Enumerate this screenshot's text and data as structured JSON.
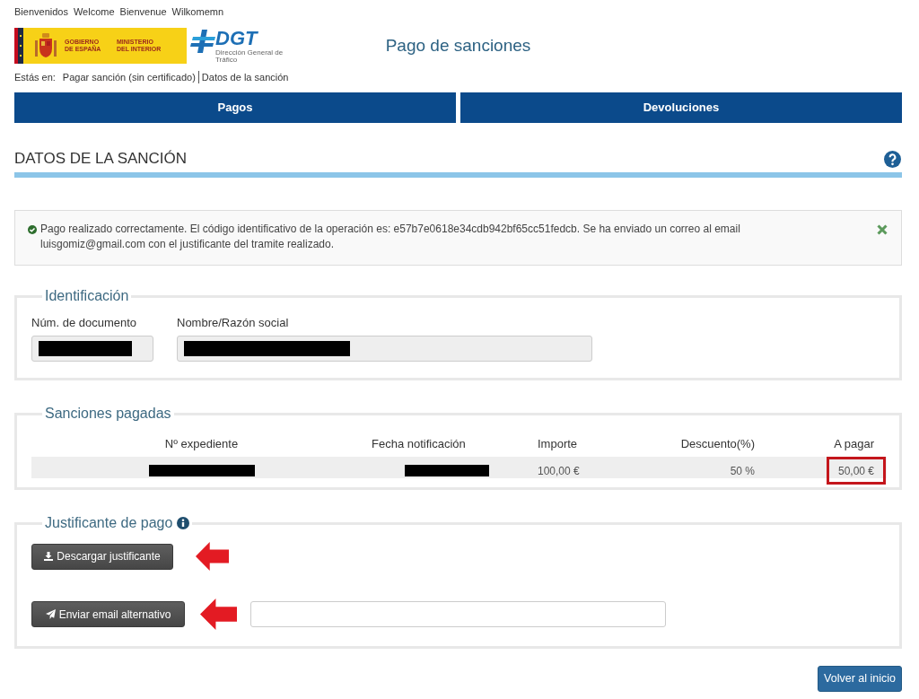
{
  "languages": [
    "Bienvenidos",
    "Welcome",
    "Bienvenue",
    "Wilkomemn"
  ],
  "header": {
    "government_logo": {
      "lines": [
        "GOBIERNO DE ESPAÑA",
        "MINISTERIO DEL INTERIOR"
      ]
    },
    "dgt_logo": {
      "name": "DGT",
      "subtitle": "Dirección General de Tráfico"
    },
    "title": "Pago de sanciones"
  },
  "breadcrumb": {
    "label": "Estás en:",
    "items": [
      "Pagar sanción (sin certificado)",
      "Datos de la sanción"
    ]
  },
  "nav": [
    "Pagos",
    "Devoluciones"
  ],
  "section_title": "DATOS DE LA SANCIÓN",
  "alert": {
    "message": "Pago realizado correctamente. El código identificativo de la operación es: e57b7e0618e34cdb942bf65cc51fedcb. Se ha enviado un correo al email luisgomiz@gmail.com con el justificante del tramite realizado."
  },
  "identificacion": {
    "legend": "Identificación",
    "fields": [
      {
        "label": "Núm. de documento",
        "disabled": true,
        "redacted": true
      },
      {
        "label": "Nombre/Razón social",
        "disabled": true,
        "redacted": true
      }
    ]
  },
  "sanciones": {
    "legend": "Sanciones pagadas",
    "columns": [
      "Nº expediente",
      "Fecha notificación",
      "Importe",
      "Descuento(%)",
      "A pagar"
    ],
    "rows": [
      {
        "cells": [
          {
            "redacted": true
          },
          {
            "redacted": true
          },
          {
            "text": "100,00 €"
          },
          {
            "text": "50 %"
          },
          {
            "text": "50,00 €",
            "highlighted": true
          }
        ]
      }
    ]
  },
  "justificante": {
    "legend": "Justificante de pago",
    "download_button": {
      "label": "Descargar justificante",
      "annotated": true
    },
    "email_button": {
      "label": "Enviar email alternativo",
      "annotated": true
    }
  },
  "back_button": "Volver al inicio"
}
